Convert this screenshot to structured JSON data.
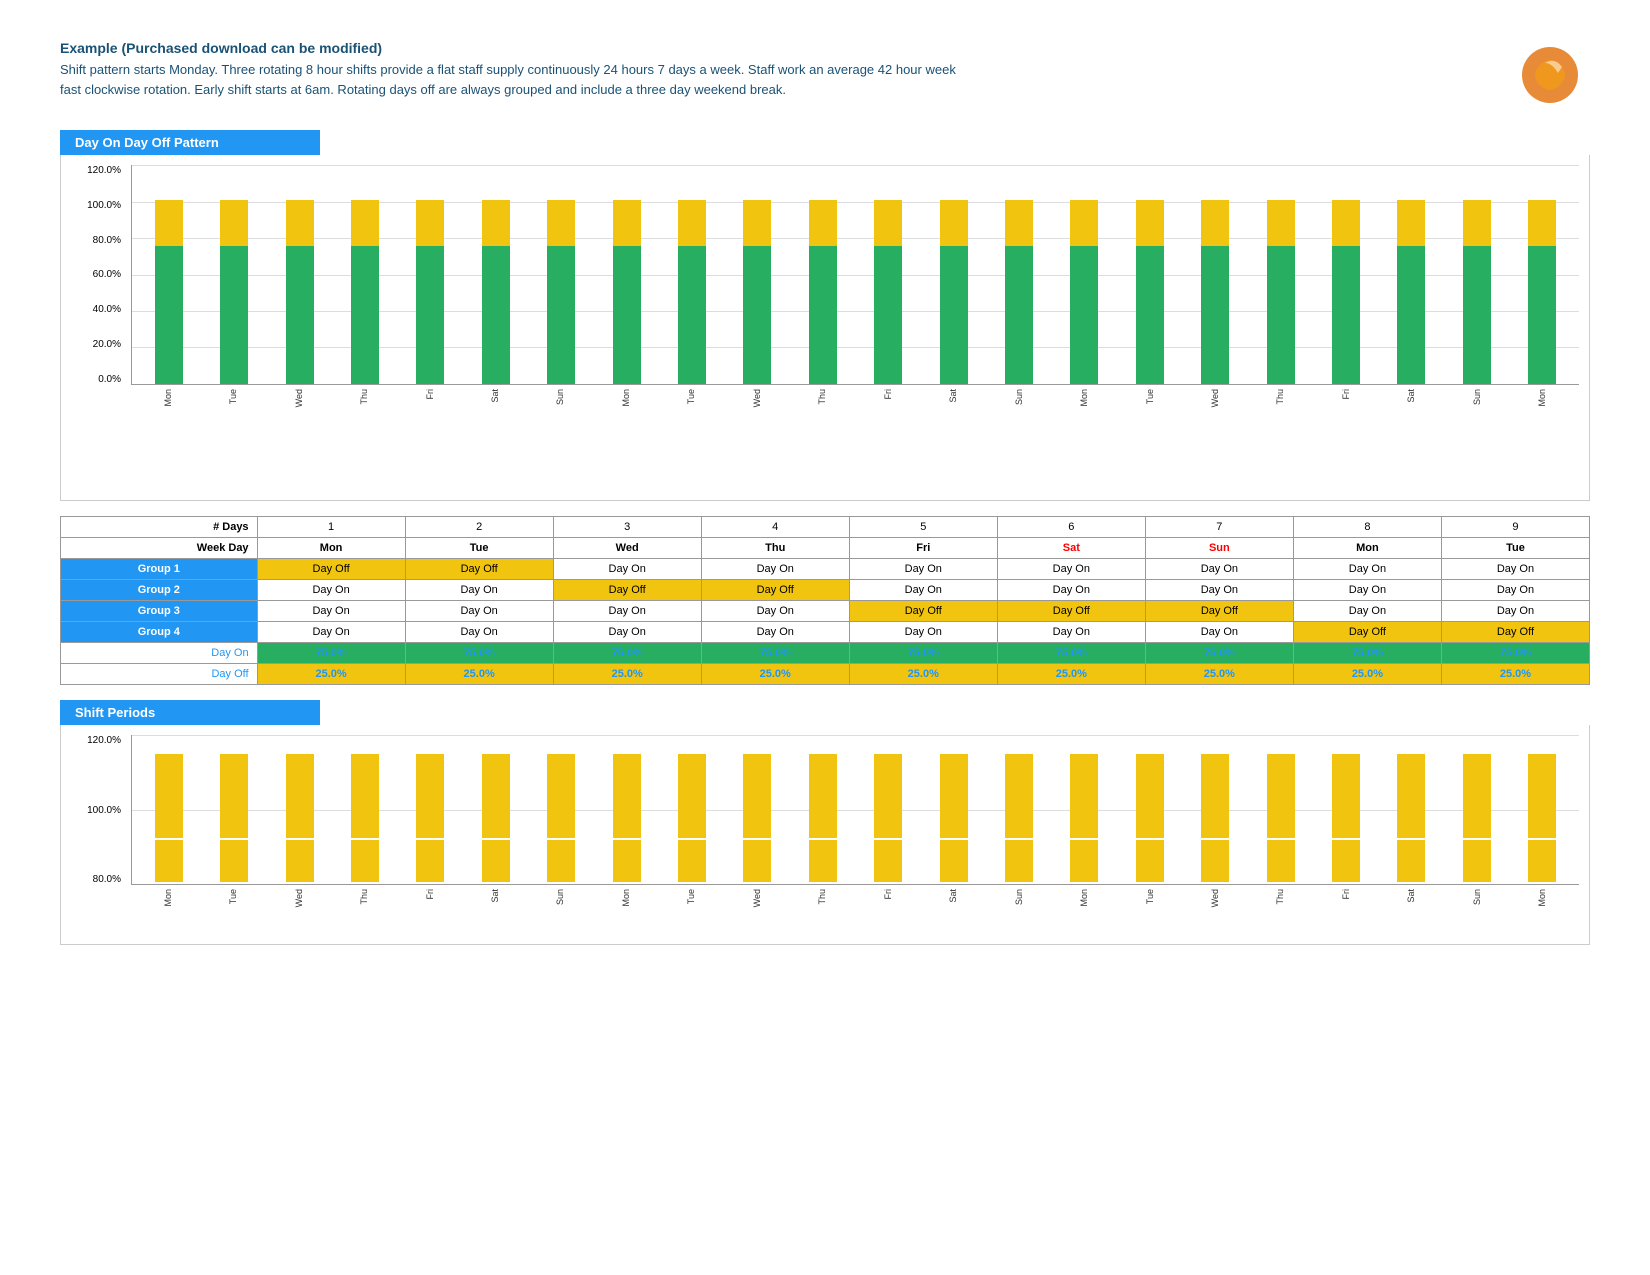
{
  "header": {
    "title": "Example (Purchased download can be modified)",
    "description": "Shift pattern starts Monday. Three rotating 8 hour  shifts provide a flat staff supply continuously 24 hours 7 days a week. Staff work an average 42 hour week fast clockwise rotation. Early shift starts at 6am. Rotating days off are always grouped  and include a three day weekend break."
  },
  "chart1": {
    "title": "Day On Day Off Pattern",
    "y_labels": [
      "0.0%",
      "20.0%",
      "40.0%",
      "60.0%",
      "80.0%",
      "100.0%",
      "120.0%"
    ],
    "x_labels": [
      "Mon",
      "Tue",
      "Wed",
      "Thu",
      "Fri",
      "Sat",
      "Sun",
      "Mon",
      "Tue",
      "Wed",
      "Thu",
      "Fri",
      "Sat",
      "Sun",
      "Mon",
      "Tue",
      "Wed",
      "Thu",
      "Fri",
      "Sat",
      "Sun",
      "Mon"
    ],
    "bars": [
      {
        "green": 75,
        "yellow": 25
      },
      {
        "green": 75,
        "yellow": 25
      },
      {
        "green": 75,
        "yellow": 25
      },
      {
        "green": 75,
        "yellow": 25
      },
      {
        "green": 75,
        "yellow": 25
      },
      {
        "green": 75,
        "yellow": 25
      },
      {
        "green": 75,
        "yellow": 25
      },
      {
        "green": 75,
        "yellow": 25
      },
      {
        "green": 75,
        "yellow": 25
      },
      {
        "green": 75,
        "yellow": 25
      },
      {
        "green": 75,
        "yellow": 25
      },
      {
        "green": 75,
        "yellow": 25
      },
      {
        "green": 75,
        "yellow": 25
      },
      {
        "green": 75,
        "yellow": 25
      },
      {
        "green": 75,
        "yellow": 25
      },
      {
        "green": 75,
        "yellow": 25
      },
      {
        "green": 75,
        "yellow": 25
      },
      {
        "green": 75,
        "yellow": 25
      },
      {
        "green": 75,
        "yellow": 25
      },
      {
        "green": 75,
        "yellow": 25
      },
      {
        "green": 75,
        "yellow": 25
      },
      {
        "green": 75,
        "yellow": 25
      }
    ]
  },
  "table": {
    "headers_days": [
      "1",
      "2",
      "3",
      "4",
      "5",
      "6",
      "7",
      "8",
      "9"
    ],
    "headers_weekdays": [
      "Mon",
      "Tue",
      "Wed",
      "Thu",
      "Fri",
      "Sat",
      "Sun",
      "Mon",
      "Tue"
    ],
    "sat_idx": 5,
    "sun_idx": 6,
    "groups": [
      {
        "label": "Group 1",
        "cells": [
          "Day Off",
          "Day Off",
          "Day On",
          "Day On",
          "Day On",
          "Day On",
          "Day On",
          "Day On",
          "Day On"
        ]
      },
      {
        "label": "Group 2",
        "cells": [
          "Day On",
          "Day On",
          "Day Off",
          "Day Off",
          "Day On",
          "Day On",
          "Day On",
          "Day On",
          "Day On"
        ]
      },
      {
        "label": "Group 3",
        "cells": [
          "Day On",
          "Day On",
          "Day On",
          "Day On",
          "Day Off",
          "Day Off",
          "Day Off",
          "Day On",
          "Day On"
        ]
      },
      {
        "label": "Group 4",
        "cells": [
          "Day On",
          "Day On",
          "Day On",
          "Day On",
          "Day On",
          "Day On",
          "Day On",
          "Day Off",
          "Day Off"
        ]
      }
    ],
    "day_on_row": [
      "75.0%",
      "75.0%",
      "75.0%",
      "75.0%",
      "75.0%",
      "75.0%",
      "75.0%",
      "75.0%",
      "75.0%"
    ],
    "day_off_row": [
      "25.0%",
      "25.0%",
      "25.0%",
      "25.0%",
      "25.0%",
      "25.0%",
      "25.0%",
      "25.0%",
      "25.0%"
    ],
    "row_label_days": "# Days",
    "row_label_weekday": "Week Day",
    "row_label_day_on": "Day On",
    "row_label_day_off": "Day Off"
  },
  "chart2": {
    "title": "Shift Periods",
    "y_labels": [
      "80.0%",
      "100.0%",
      "120.0%"
    ],
    "x_labels": [
      "Mon",
      "Tue",
      "Wed",
      "Thu",
      "Fri",
      "Sat",
      "Sun",
      "Mon",
      "Tue",
      "Wed",
      "Thu",
      "Fri",
      "Sat",
      "Sun",
      "Mon",
      "Tue",
      "Wed",
      "Thu",
      "Fri",
      "Sat",
      "Sun",
      "Mon"
    ]
  }
}
